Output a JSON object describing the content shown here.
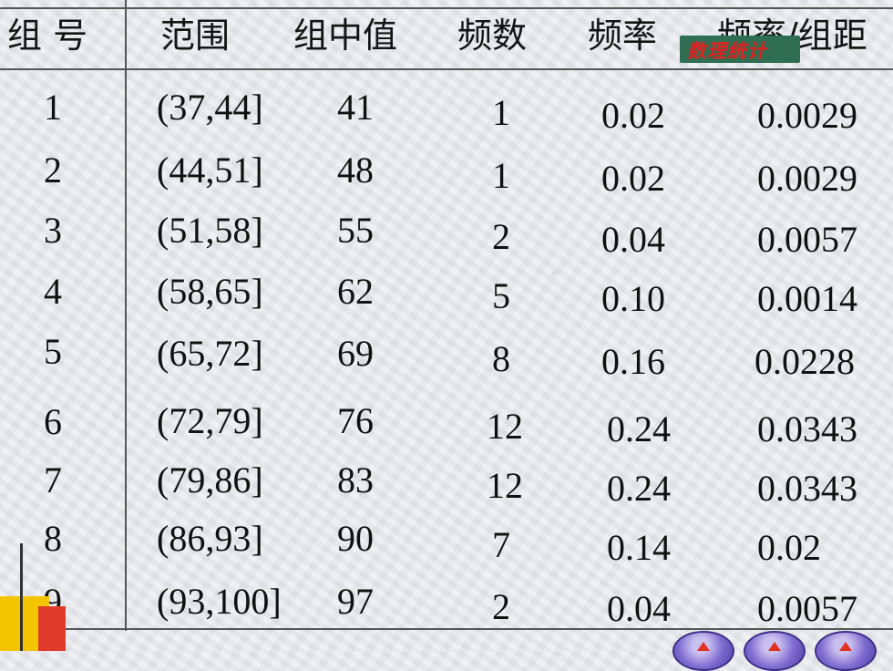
{
  "headers": {
    "group": "组 号",
    "range": "范围",
    "midpoint": "组中值",
    "frequency": "频数",
    "rate": "频率",
    "rate_per_width": "频率/组距"
  },
  "watermark": "数理统计",
  "rows": [
    {
      "group": "1",
      "range": "(37,44]",
      "mid": "41",
      "freq": "1",
      "rate": "0.02",
      "density": "0.0029"
    },
    {
      "group": "2",
      "range": "(44,51]",
      "mid": "48",
      "freq": "1",
      "rate": "0.02",
      "density": "0.0029"
    },
    {
      "group": "3",
      "range": "(51,58]",
      "mid": "55",
      "freq": "2",
      "rate": "0.04",
      "density": "0.0057"
    },
    {
      "group": "4",
      "range": "(58,65]",
      "mid": "62",
      "freq": "5",
      "rate": "0.10",
      "density": "0.0014"
    },
    {
      "group": "5",
      "range": "(65,72]",
      "mid": "69",
      "freq": "8",
      "rate": "0.16",
      "density": "0.0228"
    },
    {
      "group": "6",
      "range": "(72,79]",
      "mid": "76",
      "freq": "12",
      "rate": "0.24",
      "density": "0.0343"
    },
    {
      "group": "7",
      "range": "(79,86]",
      "mid": "83",
      "freq": "12",
      "rate": "0.24",
      "density": "0.0343"
    },
    {
      "group": "8",
      "range": "(86,93]",
      "mid": "90",
      "freq": "7",
      "rate": "0.14",
      "density": "0.02"
    },
    {
      "group": "9",
      "range": "(93,100]",
      "mid": "97",
      "freq": "2",
      "rate": "0.04",
      "density": "0.0057"
    }
  ],
  "colors": {
    "rule": "#555555",
    "watermark": "#e02020",
    "watermark_bg": "#2f6e52"
  }
}
